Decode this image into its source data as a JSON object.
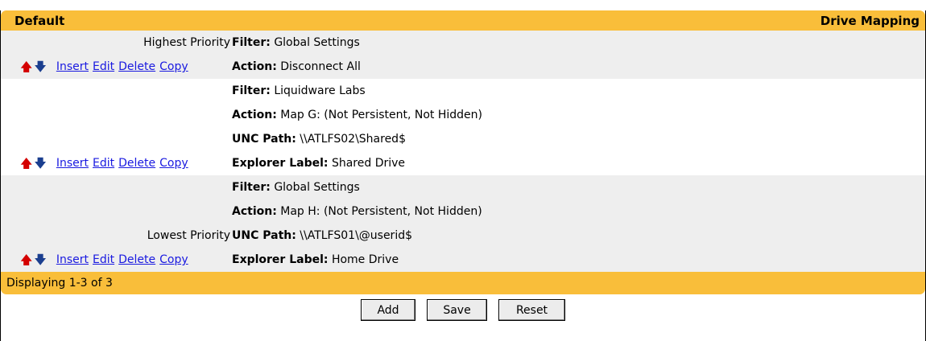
{
  "header": {
    "left": "Default",
    "right": "Drive Mapping"
  },
  "priority": {
    "highest": "Highest Priority",
    "lowest": "Lowest Priority"
  },
  "controls": {
    "insert": "Insert",
    "edit": "Edit",
    "delete": "Delete",
    "copy": "Copy"
  },
  "icons": {
    "up": "up-arrow-icon",
    "down": "down-arrow-icon"
  },
  "colors": {
    "header_bg": "#f9be3a",
    "up_arrow": "#d40000",
    "down_arrow": "#1a3e8f",
    "link": "#1a1ae0",
    "shaded_row": "#eeeeee"
  },
  "labels": {
    "filter": "Filter:",
    "action": "Action:",
    "unc": "UNC Path:",
    "explorer": "Explorer Label:"
  },
  "rows": [
    {
      "filter": "Global Settings",
      "action": "Disconnect All"
    },
    {
      "filter": "Liquidware Labs",
      "action": "Map G: (Not Persistent, Not Hidden)",
      "unc": "\\\\ATLFS02\\Shared$",
      "explorer": "Shared Drive"
    },
    {
      "filter": "Global Settings",
      "action": "Map H: (Not Persistent, Not Hidden)",
      "unc": "\\\\ATLFS01\\@userid$",
      "explorer": "Home Drive"
    }
  ],
  "footer": {
    "status": "Displaying 1-3 of 3"
  },
  "buttons": {
    "add": "Add",
    "save": "Save",
    "reset": "Reset"
  }
}
